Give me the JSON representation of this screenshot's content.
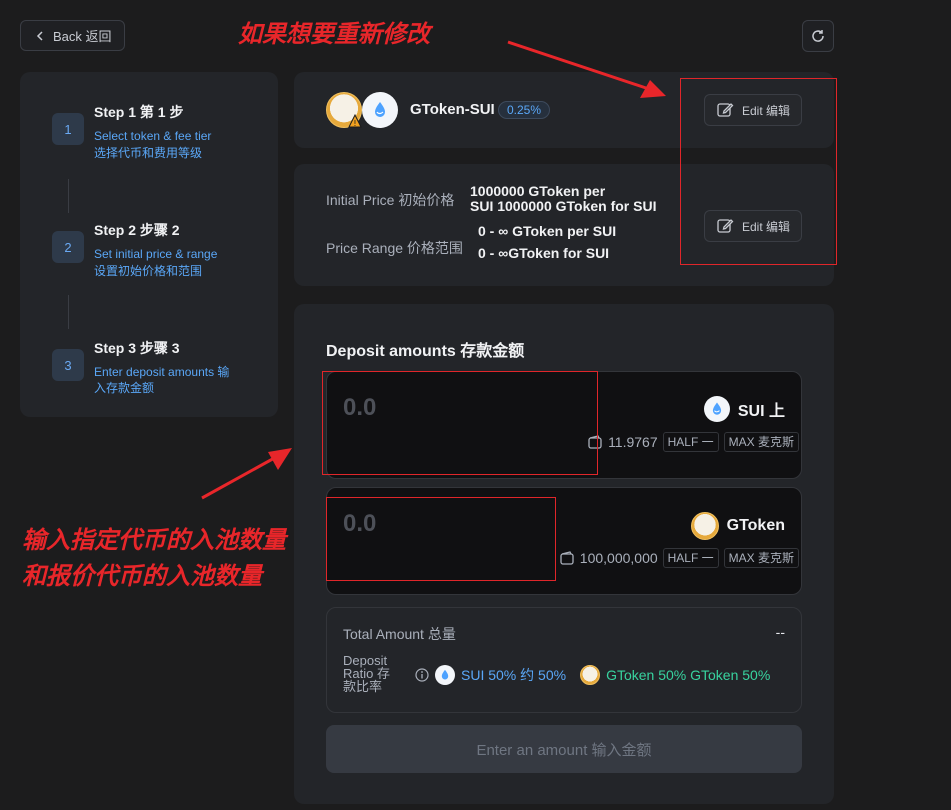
{
  "header": {
    "back_label": "Back 返回"
  },
  "steps": [
    {
      "num": "1",
      "title": "Step 1 第 1 步",
      "subtitle_en": "Select token & fee tier",
      "subtitle_cn": "选择代币和费用等级"
    },
    {
      "num": "2",
      "title": "Step 2 步骤 2",
      "subtitle_en": "Set initial price & range",
      "subtitle_cn": "设置初始价格和范围"
    },
    {
      "num": "3",
      "title": "Step 3 步骤 3",
      "subtitle_line1": "Enter deposit amounts 输",
      "subtitle_line2": "入存款金额"
    }
  ],
  "pair": {
    "name": "GToken-SUI",
    "fee": "0.25%",
    "edit_label": "Edit 编辑"
  },
  "price": {
    "initial_label": "Initial Price 初始价格",
    "initial_value_line1": "1000000 GToken per",
    "initial_value_line2": "SUI 1000000 GToken for SUI",
    "range_label": "Price Range 价格范围",
    "range_value_line1": "0 - ∞ GToken per SUI",
    "range_value_line2": "0 - ∞GToken for SUI",
    "edit_label": "Edit 编辑"
  },
  "deposit": {
    "title": "Deposit amounts 存款金额",
    "sui": {
      "amount": "0.0",
      "symbol": "SUI 上",
      "balance": "11.9767",
      "half": "HALF 一",
      "max": "MAX 麦克斯"
    },
    "gtoken": {
      "amount": "0.0",
      "symbol": "GToken",
      "balance": "100,000,000",
      "half": "HALF 一",
      "max": "MAX 麦克斯"
    },
    "total_label": "Total Amount 总量",
    "total_value": "--",
    "ratio_label_1": "Deposit",
    "ratio_label_2": "Ratio 存",
    "ratio_label_3": "款比率",
    "ratio_sui": "SUI 50% 约 50%",
    "ratio_gtoken": "GToken 50% GToken 50%",
    "cta_label": "Enter an amount 输入金额"
  },
  "annotations": {
    "top": "如果想要重新修改",
    "left_line1": "输入指定代币的入池数量",
    "left_line2": "和报价代币的入池数量"
  },
  "colors": {
    "accent_blue": "#5aa7f7",
    "accent_green": "#38d39f",
    "annotation_red": "#e8262a"
  }
}
